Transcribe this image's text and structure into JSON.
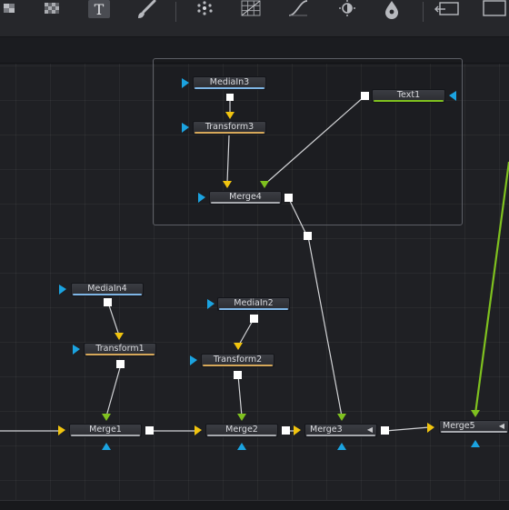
{
  "colors": {
    "port_yellow": "#f1c40f",
    "port_blue": "#1ba3e0",
    "port_green": "#7fc11f",
    "stripe_mediain": "#7fb6e6",
    "stripe_transform": "#d6a85a",
    "stripe_merge": "#a7a9ae",
    "stripe_text": "#7fc11f"
  },
  "toolbar": {
    "buttons": [
      {
        "icon": "background-checker-icon"
      },
      {
        "icon": "text-tool-icon",
        "glyph": "T"
      },
      {
        "icon": "paint-brush-icon"
      },
      {
        "icon": "particles-icon"
      },
      {
        "icon": "grid-warp-icon"
      },
      {
        "icon": "curves-icon"
      },
      {
        "icon": "color-corrector-icon"
      },
      {
        "icon": "blur-drop-icon"
      },
      {
        "icon": "loop-rectangle-icon"
      }
    ]
  },
  "nodes": {
    "mediain3": {
      "label": "MediaIn3"
    },
    "transform3": {
      "label": "Transform3"
    },
    "merge4": {
      "label": "Merge4"
    },
    "text1": {
      "label": "Text1"
    },
    "mediain4": {
      "label": "MediaIn4"
    },
    "transform1": {
      "label": "Transform1"
    },
    "mediain2": {
      "label": "MediaIn2"
    },
    "transform2": {
      "label": "Transform2"
    },
    "merge1": {
      "label": "Merge1"
    },
    "merge2": {
      "label": "Merge2"
    },
    "merge3": {
      "label": "Merge3"
    },
    "merge5": {
      "label": "Merge5"
    }
  }
}
